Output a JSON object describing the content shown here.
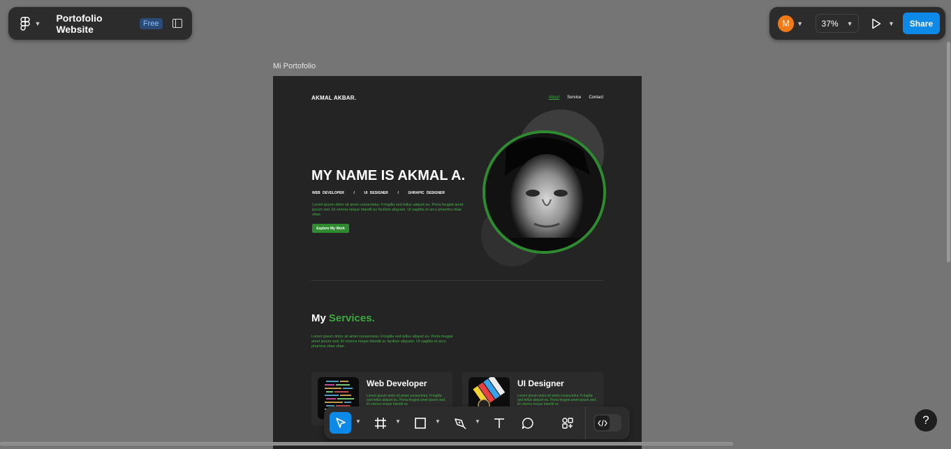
{
  "topbar": {
    "file_title": "Portofolio Website",
    "plan_badge": "Free",
    "menu_icon": "figma-logo-icon",
    "sidebar_icon": "sidebar-toggle-icon"
  },
  "toolbar_right": {
    "avatar_initial": "M",
    "avatar_color": "#f07a18",
    "zoom": "37%",
    "present_icon": "play-icon",
    "share_label": "Share"
  },
  "canvas": {
    "frame_label": "Mi Portofolio",
    "page": {
      "brand": "AKMAL AKBAR.",
      "nav": [
        "About",
        "Service",
        "Contact"
      ],
      "hero_title": "MY NAME IS AKMAL A.",
      "roles": "WEB DEVELOPER    /    UI DESIGNER    /    GHRAPIC DESIGNER",
      "hero_desc": "Lorem ipsum dolor sit amet consectetur. Fringilla sed tellus aliquet eu. Porta feugiat amet ipsum sed. Et viverra neque blandit ac facilisis aliquam. Ut sagittis et arcu pharetra vitae vitae.",
      "cta": "Explore My Work",
      "services_title_1": "My",
      "services_title_2": "Services.",
      "services_desc": "Lorem ipsum dolor sit amet consectetur. Fringilla sed tellus aliquet eu. Porta feugiat amet ipsum sed. Et viverra neque blandit ac facilisis aliquam. Ut sagittis et arcu pharetra vitae vitae.",
      "cards": [
        {
          "title": "Web Developer",
          "desc": "Lorem ipsum dolor sit amet consectetur. Fringilla sed tellus aliquet eu. Porta feugiat amet ipsum sed. Et viverra neque blandit ac"
        },
        {
          "title": "UI Designer",
          "desc": "Lorem ipsum dolor sit amet consectetur. Fringilla sed tellus aliquet eu. Porta feugiat amet ipsum sed. Et viverra neque blandit ac"
        }
      ],
      "accent_color": "#2e8b2f"
    }
  },
  "bottom_toolbar": {
    "tools": [
      "move-tool",
      "frame-tool",
      "rectangle-tool",
      "pen-tool",
      "text-tool",
      "comment-tool",
      "actions-tool"
    ],
    "selected": "move-tool",
    "devmode_icon": "code-icon"
  },
  "help_label": "?"
}
